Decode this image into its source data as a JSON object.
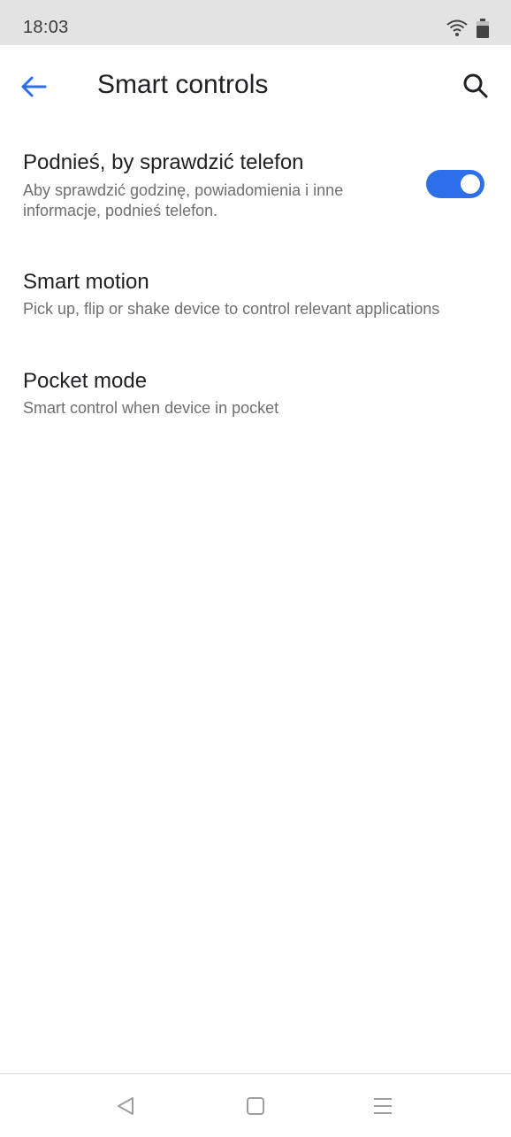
{
  "status_bar": {
    "time": "18:03",
    "icons": [
      "wifi-icon",
      "battery-icon"
    ]
  },
  "header": {
    "title": "Smart controls",
    "back_icon": "arrow-left-icon",
    "search_icon": "search-icon"
  },
  "settings": [
    {
      "title": "Podnieś, by sprawdzić telefon",
      "summary": "Aby sprawdzić godzinę, powiadomienia i inne informacje, podnieś telefon.",
      "toggle": true
    },
    {
      "title": "Smart motion",
      "summary": "Pick up, flip or shake device to control relevant applications"
    },
    {
      "title": "Pocket mode",
      "summary": "Smart control when device in pocket"
    }
  ],
  "nav_bar": {
    "icons": [
      "back-triangle-icon",
      "home-square-icon",
      "menu-lines-icon"
    ]
  },
  "colors": {
    "accent": "#2d6fe8",
    "status_bar_bg": "#e3e3e3",
    "secondary_text": "#6f6f6f"
  }
}
